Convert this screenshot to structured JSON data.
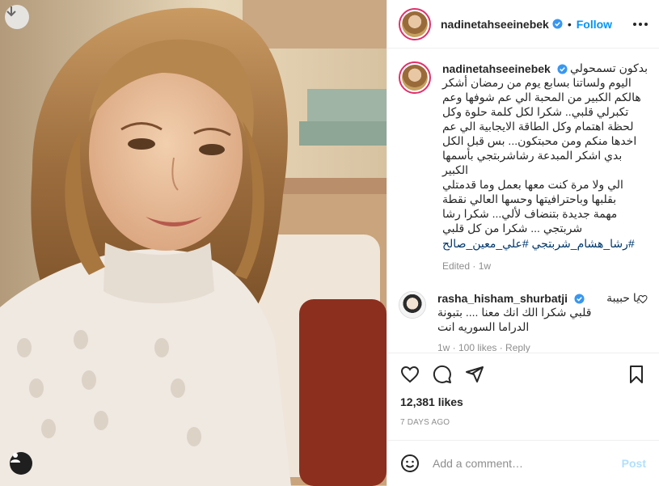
{
  "post": {
    "author": {
      "username": "nadinetahseeinebek",
      "verified": true,
      "follow_label": "Follow",
      "separator": "•"
    },
    "caption": {
      "first_line": "بدكون تسمحولي",
      "text": "اليوم ولساتنا بسابع يوم من رمضان أشكر\nهالكم الكبير من المحبة الي عم شوفها وعم\nتكبرلي قلبي.. شكرا لكل كلمة حلوة وكل\nلحظة اهتمام وكل الطاقة الايجابية الي عم\nاخدها منكم ومن محبتكون... بس قبل الكل\nبدي اشكر المبدعة رشاشربتجي بأسمها الكبير\nالي ولا مرة كنت معها بعمل وما قدمتلي\nبقلبها وباحترافيتها وحسها العالي نقطة\nمهمة جديدة بتنضاف لألي... شكرا رشا\nشربتجي ... شكرا من كل قلبي",
      "hashtags": "#رشا_هشام_شربتجي #علي_معين_صالح",
      "edited_label": "Edited",
      "time": "1w"
    },
    "comment": {
      "username": "rasha_hisham_shurbatji",
      "verified": true,
      "first": "يا حبيبة",
      "text": "قلبي شكرا الك انك معنا .... بتبونة\nالدراما السوريه انت",
      "meta": "1w · 100 likes · Reply"
    },
    "likes": "12,381 likes",
    "age": "7 DAYS AGO",
    "add_comment_placeholder": "Add a comment…",
    "post_label": "Post"
  },
  "icons": {
    "download": "download-icon",
    "user_tag": "user-icon",
    "like": "heart-icon",
    "comment": "comment-icon",
    "share": "paper-plane-icon",
    "save": "bookmark-icon",
    "emoji": "smiley-icon",
    "more": "more-horizontal-icon"
  },
  "colors": {
    "accent": "#0095f6",
    "link": "#00376b",
    "secondary_text": "#8e8e8e",
    "post_disabled": "#b2dffc"
  }
}
